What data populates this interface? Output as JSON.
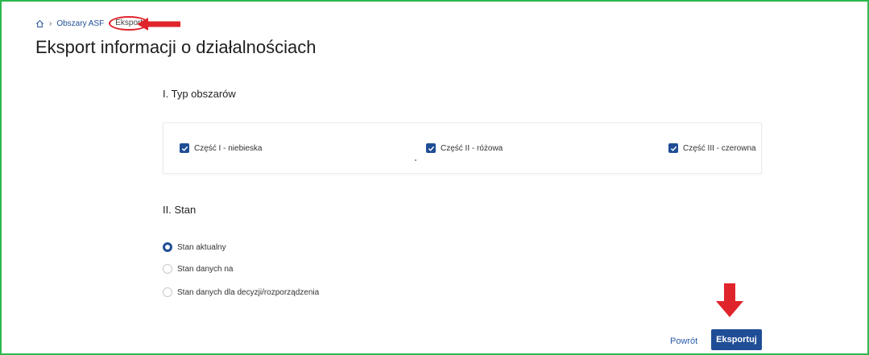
{
  "breadcrumb": {
    "home_icon": "home-icon",
    "separator": "›",
    "items": [
      "Obszary ASF",
      "Eksport"
    ]
  },
  "page": {
    "title": "Eksport informacji o działalnościach"
  },
  "section_types": {
    "title": "I. Typ obszarów",
    "checkboxes": [
      {
        "label": "Część I - niebieska",
        "checked": true
      },
      {
        "label": "Część II - różowa",
        "checked": true
      },
      {
        "label": "Część III - czerowna",
        "checked": true
      }
    ]
  },
  "section_state": {
    "title": "II. Stan",
    "radios": [
      {
        "label": "Stan aktualny",
        "checked": true
      },
      {
        "label": "Stan danych na",
        "checked": false
      },
      {
        "label": "Stan danych dla decyzji/rozporządzenia",
        "checked": false
      }
    ]
  },
  "actions": {
    "back_label": "Powrót",
    "export_label": "Eksportuj"
  },
  "colors": {
    "primary": "#1f4e96",
    "annotation": "#e0242b",
    "frame": "#2db84d"
  }
}
